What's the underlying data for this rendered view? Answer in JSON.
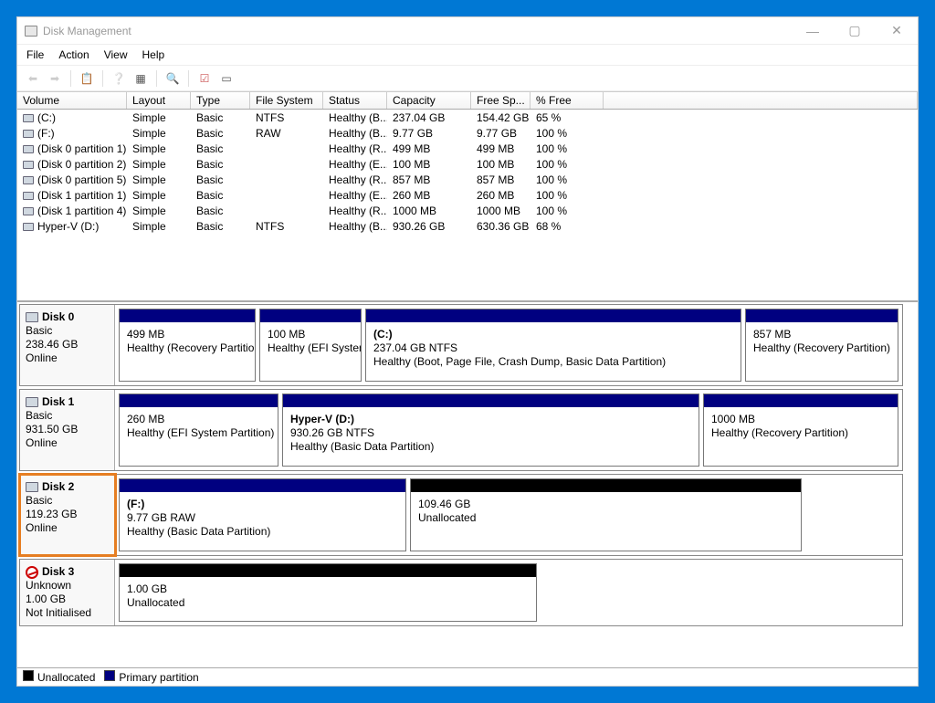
{
  "window": {
    "title": "Disk Management",
    "controls": {
      "min": "—",
      "max": "▢",
      "close": "✕"
    }
  },
  "menu": {
    "file": "File",
    "action": "Action",
    "view": "View",
    "help": "Help"
  },
  "columns": [
    "Volume",
    "Layout",
    "Type",
    "File System",
    "Status",
    "Capacity",
    "Free Sp...",
    "% Free"
  ],
  "volumes": [
    {
      "name": "(C:)",
      "layout": "Simple",
      "type": "Basic",
      "fs": "NTFS",
      "status": "Healthy (B...",
      "cap": "237.04 GB",
      "free": "154.42 GB",
      "pct": "65 %"
    },
    {
      "name": "(F:)",
      "layout": "Simple",
      "type": "Basic",
      "fs": "RAW",
      "status": "Healthy (B...",
      "cap": "9.77 GB",
      "free": "9.77 GB",
      "pct": "100 %"
    },
    {
      "name": "(Disk 0 partition 1)",
      "layout": "Simple",
      "type": "Basic",
      "fs": "",
      "status": "Healthy (R...",
      "cap": "499 MB",
      "free": "499 MB",
      "pct": "100 %"
    },
    {
      "name": "(Disk 0 partition 2)",
      "layout": "Simple",
      "type": "Basic",
      "fs": "",
      "status": "Healthy (E...",
      "cap": "100 MB",
      "free": "100 MB",
      "pct": "100 %"
    },
    {
      "name": "(Disk 0 partition 5)",
      "layout": "Simple",
      "type": "Basic",
      "fs": "",
      "status": "Healthy (R...",
      "cap": "857 MB",
      "free": "857 MB",
      "pct": "100 %"
    },
    {
      "name": "(Disk 1 partition 1)",
      "layout": "Simple",
      "type": "Basic",
      "fs": "",
      "status": "Healthy (E...",
      "cap": "260 MB",
      "free": "260 MB",
      "pct": "100 %"
    },
    {
      "name": "(Disk 1 partition 4)",
      "layout": "Simple",
      "type": "Basic",
      "fs": "",
      "status": "Healthy (R...",
      "cap": "1000 MB",
      "free": "1000 MB",
      "pct": "100 %"
    },
    {
      "name": "Hyper-V (D:)",
      "layout": "Simple",
      "type": "Basic",
      "fs": "NTFS",
      "status": "Healthy (B...",
      "cap": "930.26 GB",
      "free": "630.36 GB",
      "pct": "68 %"
    }
  ],
  "disks": {
    "d0": {
      "name": "Disk 0",
      "type": "Basic",
      "size": "238.46 GB",
      "state": "Online",
      "p": [
        {
          "t": "",
          "l1": "499 MB",
          "l2": "Healthy (Recovery Partition)",
          "bar": "navy"
        },
        {
          "t": "",
          "l1": "100 MB",
          "l2": "Healthy (EFI System",
          "bar": "navy"
        },
        {
          "t": " (C:)",
          "l1": "237.04 GB NTFS",
          "l2": "Healthy (Boot, Page File, Crash Dump, Basic Data Partition)",
          "bar": "navy"
        },
        {
          "t": "",
          "l1": "857 MB",
          "l2": "Healthy (Recovery Partition)",
          "bar": "navy"
        }
      ]
    },
    "d1": {
      "name": "Disk 1",
      "type": "Basic",
      "size": "931.50 GB",
      "state": "Online",
      "p": [
        {
          "t": "",
          "l1": "260 MB",
          "l2": "Healthy (EFI System Partition)",
          "bar": "navy"
        },
        {
          "t": "Hyper-V  (D:)",
          "l1": "930.26 GB NTFS",
          "l2": "Healthy (Basic Data Partition)",
          "bar": "navy"
        },
        {
          "t": "",
          "l1": "1000 MB",
          "l2": "Healthy (Recovery Partition)",
          "bar": "navy"
        }
      ]
    },
    "d2": {
      "name": "Disk 2",
      "type": "Basic",
      "size": "119.23 GB",
      "state": "Online",
      "p": [
        {
          "t": " (F:)",
          "l1": "9.77 GB RAW",
          "l2": "Healthy (Basic Data Partition)",
          "bar": "navy"
        },
        {
          "t": "",
          "l1": "109.46 GB",
          "l2": "Unallocated",
          "bar": "black"
        }
      ]
    },
    "d3": {
      "name": "Disk 3",
      "type": "Unknown",
      "size": "1.00 GB",
      "state": "Not Initialised",
      "p": [
        {
          "t": "",
          "l1": "1.00 GB",
          "l2": "Unallocated",
          "bar": "black"
        }
      ]
    }
  },
  "legend": {
    "unalloc": "Unallocated",
    "primary": "Primary partition"
  }
}
